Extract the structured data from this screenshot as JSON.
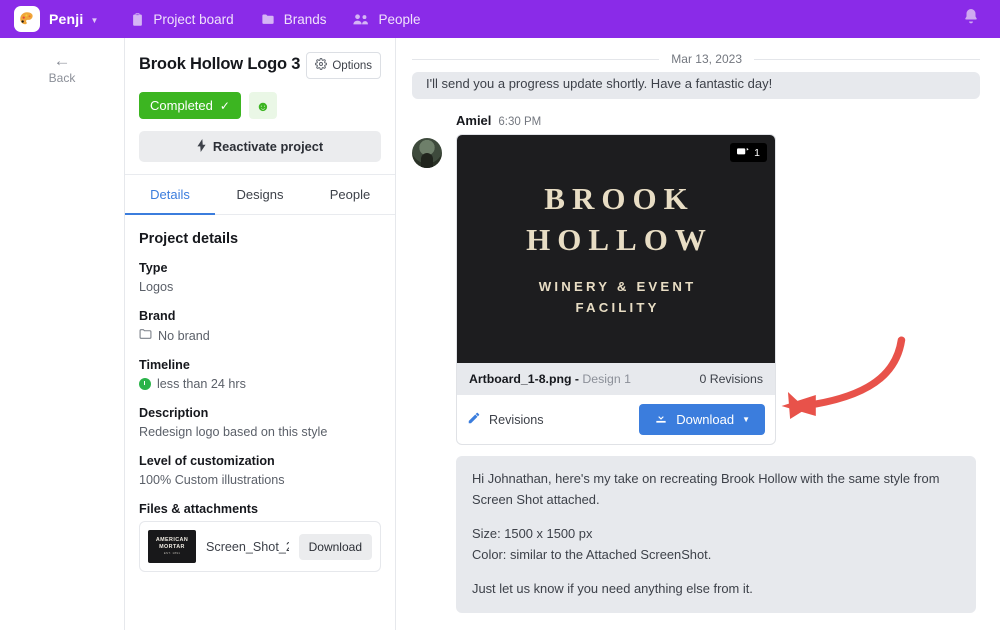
{
  "topnav": {
    "logo_icon": "palette-icon",
    "brand": "Penji",
    "caret_icon": "chevron-down-icon",
    "items": [
      {
        "label": "Project board",
        "icon": "clipboard-icon"
      },
      {
        "label": "Brands",
        "icon": "folder-icon"
      },
      {
        "label": "People",
        "icon": "people-icon"
      }
    ],
    "bell_icon": "bell-icon",
    "bg_color": "#8a2be8"
  },
  "back": {
    "label": "Back",
    "icon": "arrow-left-icon"
  },
  "left_panel": {
    "title": "Brook Hollow Logo 3",
    "options_label": "Options",
    "options_icon": "gear-icon",
    "status": {
      "label": "Completed",
      "check_icon": "check-icon",
      "color": "#3cb521"
    },
    "emoji_icon": "smiley-icon",
    "reactivate": {
      "label": "Reactivate project",
      "icon": "bolt-icon"
    },
    "tabs": [
      {
        "label": "Details",
        "active": true
      },
      {
        "label": "Designs",
        "active": false
      },
      {
        "label": "People",
        "active": false
      }
    ],
    "section_title": "Project details",
    "fields": [
      {
        "label": "Type",
        "value": "Logos",
        "icon": ""
      },
      {
        "label": "Brand",
        "value": "No brand",
        "icon": "folder-icon"
      },
      {
        "label": "Timeline",
        "value": "less than 24 hrs",
        "icon": "clock-icon"
      },
      {
        "label": "Description",
        "value": "Redesign logo based on this style",
        "icon": ""
      },
      {
        "label": "Level of customization",
        "value": "100% Custom illustrations",
        "icon": ""
      }
    ],
    "files_label": "Files & attachments",
    "attachment": {
      "name": "Screen_Shot_2...",
      "download_label": "Download",
      "thumb_line1": "AMERICAN",
      "thumb_line2": "MORTAR",
      "thumb_line3": "EST. 1891"
    }
  },
  "chat": {
    "date_separator": "Mar 13, 2023",
    "clipped_message": "I'll send you a progress update shortly. Have a fantastic day!",
    "message": {
      "author": "Amiel",
      "time": "6:30 PM",
      "avatar_icon": "user-avatar"
    },
    "design_card": {
      "count_badge": "1",
      "count_icon": "images-icon",
      "logo_line1": "BROOK",
      "logo_line2": "HOLLOW",
      "logo_sub_line1": "WINERY & EVENT",
      "logo_sub_line2": "FACILITY",
      "file_name": "Artboard_1-8.png -",
      "design_label": "Design 1",
      "revisions_count": "0 Revisions",
      "revisions_link": "Revisions",
      "revisions_icon": "pencil-icon",
      "download_label": "Download",
      "download_icon": "download-icon",
      "download_caret": "chevron-down-icon",
      "download_color": "#3b7ddd"
    },
    "body_text": {
      "p1": "Hi Johnathan, here's my take on recreating Brook Hollow with the same style from Screen Shot attached.",
      "p2_l1": "Size: 1500 x 1500 px",
      "p2_l2": "Color: similar to the Attached ScreenShot.",
      "p3": "Just let us know if you need anything else from it."
    }
  },
  "annotation": {
    "arrow_color": "#e8524a",
    "name": "red-arrow-annotation"
  }
}
